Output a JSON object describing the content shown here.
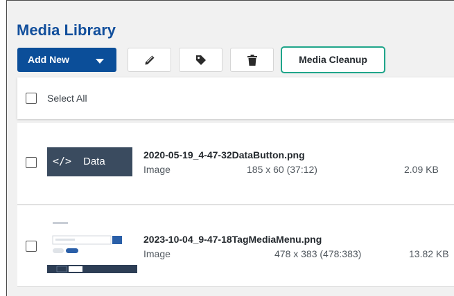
{
  "header": {
    "title": "Media Library"
  },
  "toolbar": {
    "add_new_label": "Add New",
    "edit_icon": "pencil-icon",
    "tag_icon": "tag-icon",
    "delete_icon": "trash-icon",
    "cleanup_label": "Media Cleanup"
  },
  "select_all": {
    "label": "Select All",
    "checked": false
  },
  "items": [
    {
      "filename": "2020-05-19_4-47-32DataButton.png",
      "type": "Image",
      "dimensions": "185 x 60 (37:12)",
      "size": "2.09 KB",
      "thumb_text": "Data",
      "checked": false
    },
    {
      "filename": "2023-10-04_9-47-18TagMediaMenu.png",
      "type": "Image",
      "dimensions": "478 x 383 (478:383)",
      "size": "13.82 KB",
      "checked": false
    }
  ],
  "colors": {
    "accent": "#0b4e99",
    "title": "#124f9c",
    "cleanup_border": "#1fa58a",
    "thumb_bg": "#3a4b5f"
  }
}
